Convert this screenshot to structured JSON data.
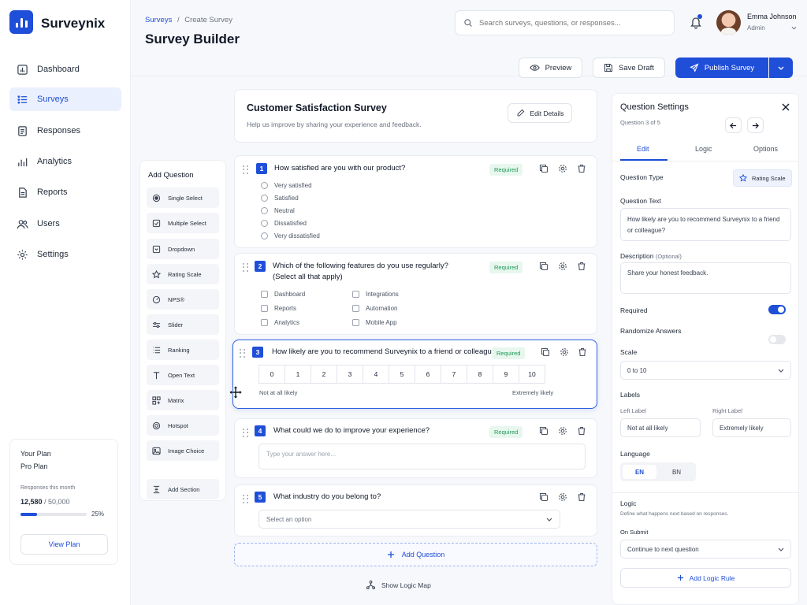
{
  "app": {
    "name": "Surveynix"
  },
  "sidebar": {
    "items": [
      {
        "label": "Dashboard",
        "icon": "dashboard-icon",
        "active": false
      },
      {
        "label": "Surveys",
        "icon": "list-icon",
        "active": true
      },
      {
        "label": "Responses",
        "icon": "document-icon",
        "active": false
      },
      {
        "label": "Analytics",
        "icon": "analytics-icon",
        "active": false
      },
      {
        "label": "Reports",
        "icon": "report-icon",
        "active": false
      },
      {
        "label": "Users",
        "icon": "users-icon",
        "active": false
      },
      {
        "label": "Settings",
        "icon": "gear-icon",
        "active": false
      }
    ],
    "plan": {
      "heading": "Your Plan",
      "name": "Pro Plan",
      "usage_label": "Responses this month",
      "used": "12,580",
      "limit": " / 50,000",
      "percent_label": "25%",
      "progress": 0.25,
      "button": "View Plan"
    }
  },
  "header": {
    "breadcrumb_parent": "Surveys",
    "breadcrumb_sep": "/",
    "breadcrumb_current": "Create Survey",
    "title": "Survey Builder",
    "search_placeholder": "Search surveys, questions, or responses...",
    "user_name": "Emma Johnson",
    "user_role": "Admin"
  },
  "toolbar": {
    "preview": "Preview",
    "save_draft": "Save Draft",
    "publish": "Publish Survey"
  },
  "survey": {
    "title": "Customer Satisfaction Survey",
    "description": "Help us improve by sharing your experience and feedback.",
    "edit_details": "Edit Details"
  },
  "add_question": {
    "heading": "Add Question",
    "types": [
      {
        "label": "Single Select",
        "icon": "radio-icon"
      },
      {
        "label": "Multiple Select",
        "icon": "checkbox-icon"
      },
      {
        "label": "Dropdown",
        "icon": "dropdown-icon"
      },
      {
        "label": "Rating Scale",
        "icon": "star-icon"
      },
      {
        "label": "NPS®",
        "icon": "gauge-icon"
      },
      {
        "label": "Slider",
        "icon": "slider-icon"
      },
      {
        "label": "Ranking",
        "icon": "ranking-icon"
      },
      {
        "label": "Open Text",
        "icon": "text-icon"
      },
      {
        "label": "Matrix",
        "icon": "matrix-icon"
      },
      {
        "label": "Hotspot",
        "icon": "target-icon"
      },
      {
        "label": "Image Choice",
        "icon": "image-icon"
      }
    ],
    "add_section": "Add Section"
  },
  "questions": {
    "q1": {
      "num": "1",
      "text": "How satisfied are you with our product?",
      "required": "Required",
      "options": [
        "Very satisfied",
        "Satisfied",
        "Neutral",
        "Dissatisfied",
        "Very dissatisfied"
      ]
    },
    "q2": {
      "num": "2",
      "text": "Which of the following features do you use regularly?",
      "text2": "(Select all that apply)",
      "required": "Required",
      "options": [
        "Dashboard",
        "Reports",
        "Analytics",
        "Integrations",
        "Automation",
        "Mobile App"
      ]
    },
    "q3": {
      "num": "3",
      "text": "How likely are you to recommend Surveynix to a friend or colleague?",
      "required": "Required",
      "scale": [
        "0",
        "1",
        "2",
        "3",
        "4",
        "5",
        "6",
        "7",
        "8",
        "9",
        "10"
      ],
      "left_label": "Not at all likely",
      "right_label": "Extremely likely"
    },
    "q4": {
      "num": "4",
      "text": "What could we do to improve your experience?",
      "required": "Required",
      "placeholder": "Type your answer here..."
    },
    "q5": {
      "num": "5",
      "text": "What industry do you belong to?",
      "placeholder": "Select an option"
    }
  },
  "footer_actions": {
    "add_question": "Add Question",
    "logic_map": "Show Logic Map"
  },
  "settings": {
    "title": "Question Settings",
    "position": "Question 3 of 5",
    "tabs": [
      "Edit",
      "Logic",
      "Options"
    ],
    "active_tab": "Edit",
    "question_type_label": "Question Type",
    "question_type_value": "Rating Scale",
    "question_text_label": "Question Text",
    "question_text_value": "How likely are you to recommend Surveynix to a friend or colleague?",
    "description_label": "Description",
    "description_optional": "(Optional)",
    "description_value": "Share your honest feedback.",
    "required_label": "Required",
    "required_on": true,
    "randomize_label": "Randomize Answers",
    "randomize_on": false,
    "scale_label": "Scale",
    "scale_value": "0 to 10",
    "labels_heading": "Labels",
    "left_label_heading": "Left Label",
    "left_label_value": "Not at all likely",
    "right_label_heading": "Right Label",
    "right_label_value": "Extremely likely",
    "language_label": "Language",
    "languages": [
      "EN",
      "BN"
    ],
    "logic_heading": "Logic",
    "logic_desc": "Define what happens next based on responses.",
    "on_submit_label": "On Submit",
    "on_submit_value": "Continue to next question",
    "add_logic_rule": "Add Logic Rule"
  },
  "colors": {
    "accent": "#1f4ed8",
    "required_bg": "#e7f7ee",
    "required_text": "#1e9a57"
  }
}
